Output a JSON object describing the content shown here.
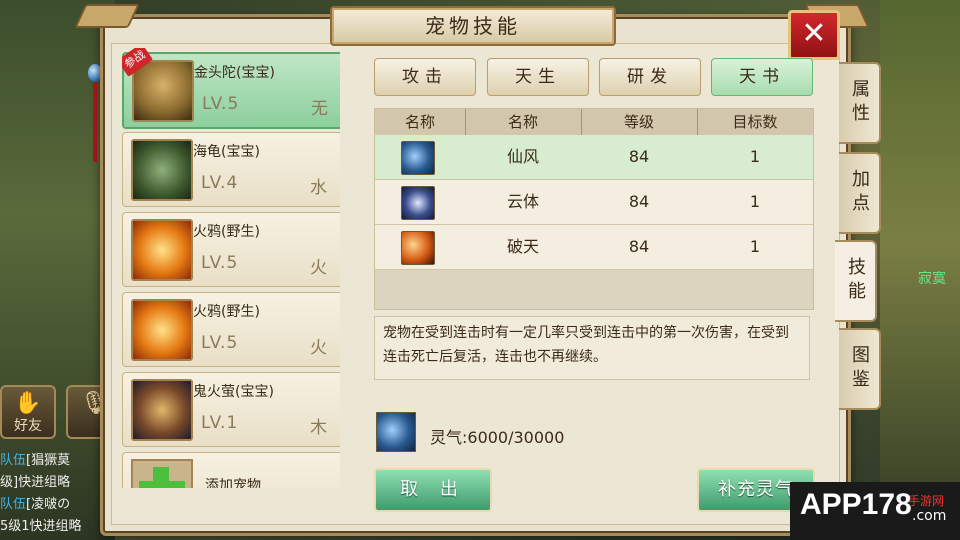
{
  "title": "宠物技能",
  "close_label": "✕",
  "side_tabs": [
    "属性",
    "加点",
    "技能",
    "图鉴"
  ],
  "pet_tabs": [
    "攻击",
    "天生",
    "研发",
    "天书"
  ],
  "pets": [
    {
      "name": "金头陀(宝宝)",
      "level": "LV.5",
      "element": "无",
      "badge": "参战"
    },
    {
      "name": "海龟(宝宝)",
      "level": "LV.4",
      "element": "水"
    },
    {
      "name": "火鸦(野生)",
      "level": "LV.5",
      "element": "火"
    },
    {
      "name": "火鸦(野生)",
      "level": "LV.5",
      "element": "火"
    },
    {
      "name": "鬼火萤(宝宝)",
      "level": "LV.1",
      "element": "木"
    },
    {
      "name": "添加宠物"
    }
  ],
  "table": {
    "headers": [
      "名称",
      "名称",
      "等级",
      "目标数"
    ],
    "rows": [
      {
        "name": "仙风",
        "level": "84",
        "targets": "1",
        "icon": "xianfeng-icon"
      },
      {
        "name": "云体",
        "level": "84",
        "targets": "1",
        "icon": "yunti-icon"
      },
      {
        "name": "破天",
        "level": "84",
        "targets": "1",
        "icon": "potian-icon"
      }
    ]
  },
  "description": "宠物在受到连击时有一定几率只受到连击中的第一次伤害，在受到连击死亡后复活，连击也不再继续。",
  "energy": "灵气:6000/30000",
  "buttons": {
    "exit": "取 出",
    "refill": "补充灵气"
  },
  "hud": {
    "friends": "好友",
    "chat": [
      {
        "tag": "队伍",
        "text": "[猖獗莫"
      },
      {
        "tag": "",
        "text": "级]快进组略"
      },
      {
        "tag": "队伍",
        "text": "[凌啵の"
      },
      {
        "tag": "",
        "text": "5级1快进组略"
      }
    ],
    "right_name": "寂寞"
  },
  "watermark": {
    "main": "APP178",
    "sub": "手游网",
    "domain": ".com"
  },
  "colors": {
    "accent": "#5aa76c",
    "close": "#c1191c",
    "frame": "#a78b5a"
  }
}
